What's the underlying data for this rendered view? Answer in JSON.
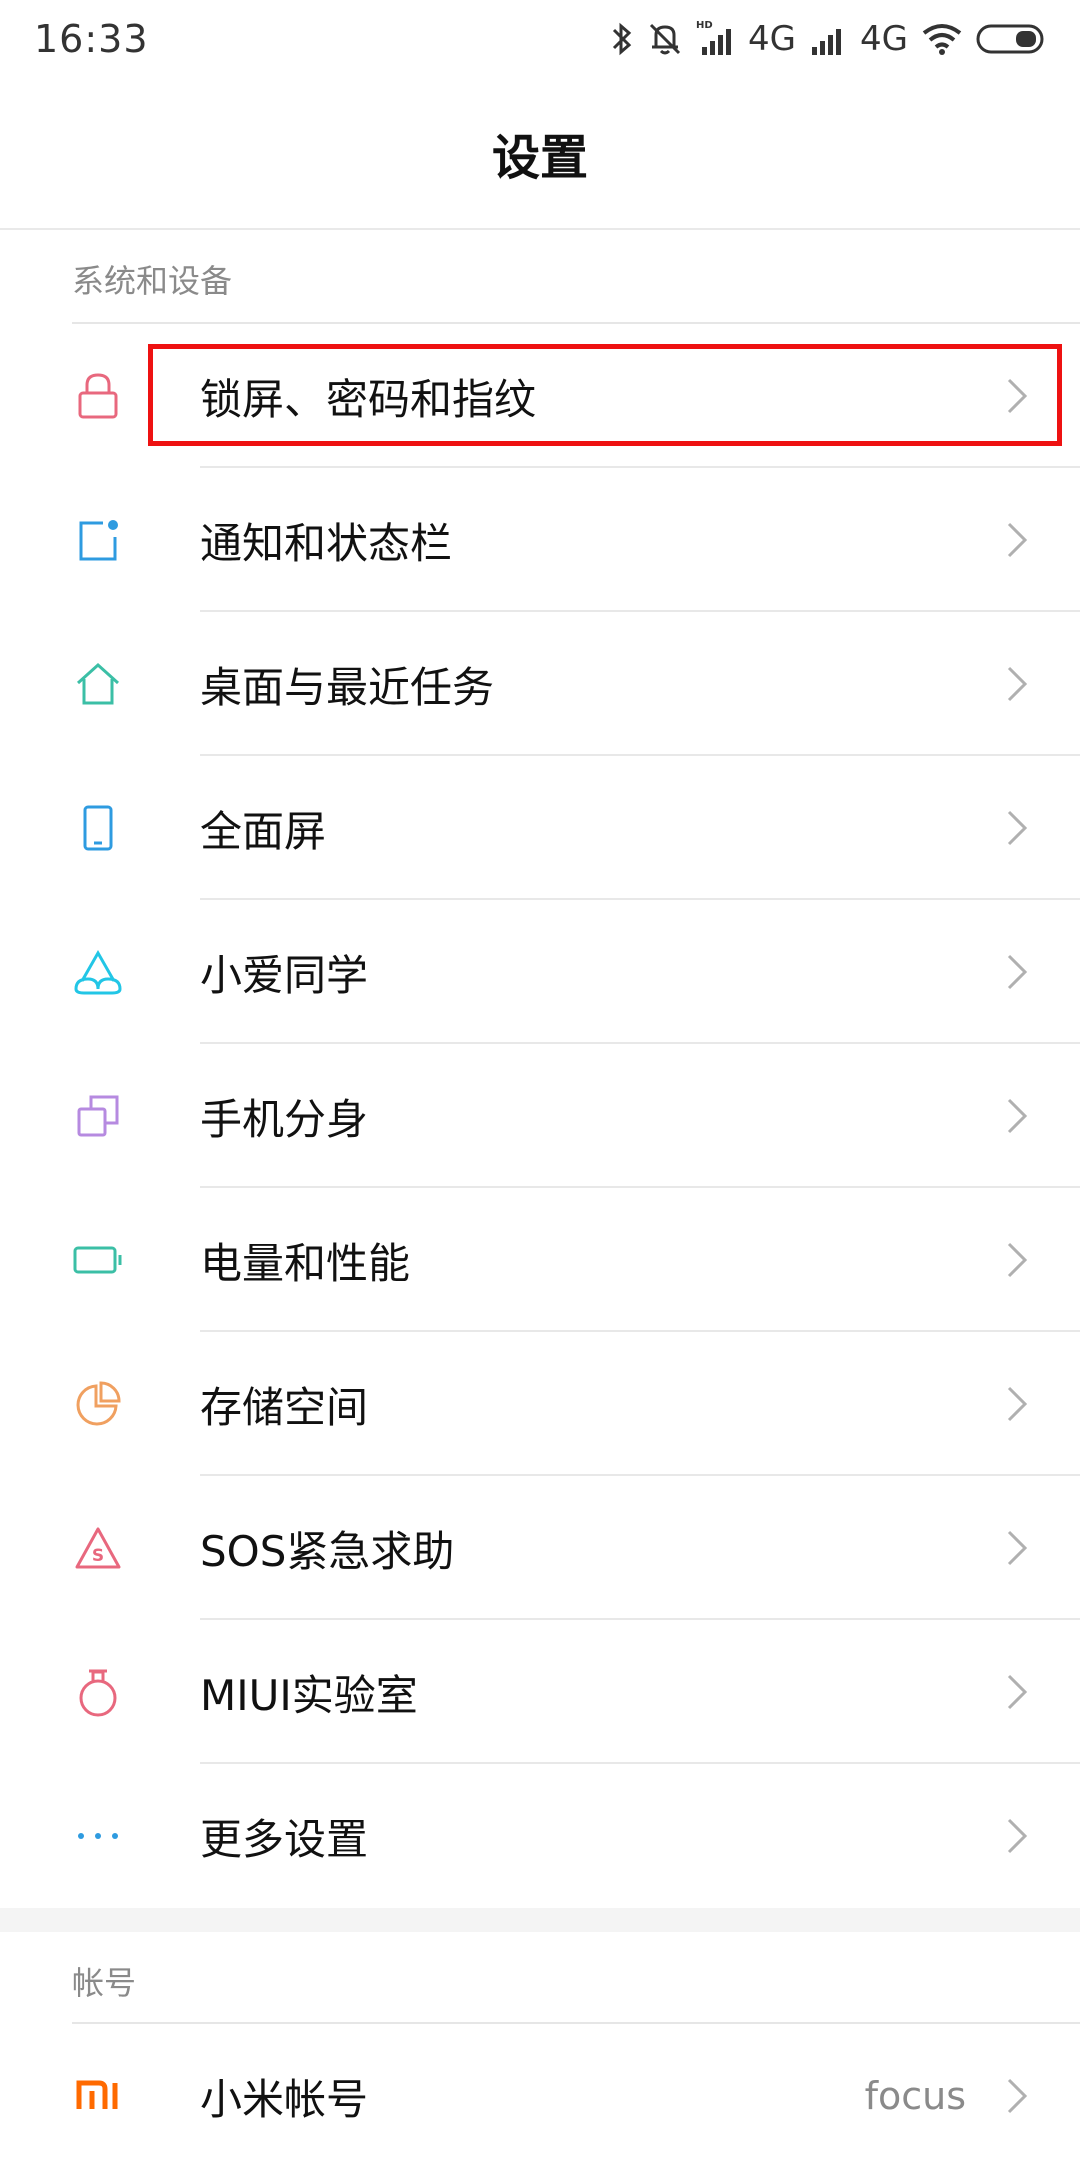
{
  "status_bar": {
    "time": "16:33",
    "network_1": "4G",
    "network_2": "4G",
    "hd_label": "HD",
    "icons": [
      "bluetooth-icon",
      "vibrate-off-icon",
      "signal-icon",
      "signal-icon",
      "wifi-icon",
      "battery-icon"
    ]
  },
  "header": {
    "title": "设置"
  },
  "sections": [
    {
      "label": "系统和设备",
      "items": [
        {
          "label": "锁屏、密码和指纹",
          "icon": "lock-icon",
          "color": "#e8687e"
        },
        {
          "label": "通知和状态栏",
          "icon": "notification-icon",
          "color": "#2e9be0"
        },
        {
          "label": "桌面与最近任务",
          "icon": "home-icon",
          "color": "#3bbfa6"
        },
        {
          "label": "全面屏",
          "icon": "phone-screen-icon",
          "color": "#2e9be0"
        },
        {
          "label": "小爱同学",
          "icon": "xiaoai-icon",
          "color": "#22c6e6"
        },
        {
          "label": "手机分身",
          "icon": "second-space-icon",
          "color": "#b68ae0"
        },
        {
          "label": "电量和性能",
          "icon": "battery-icon",
          "color": "#3bbfa6"
        },
        {
          "label": "存储空间",
          "icon": "storage-pie-icon",
          "color": "#f0a060"
        },
        {
          "label": "SOS紧急求助",
          "icon": "sos-icon",
          "color": "#e8687e"
        },
        {
          "label": "MIUI实验室",
          "icon": "flask-icon",
          "color": "#e8687e"
        },
        {
          "label": "更多设置",
          "icon": "more-dots-icon",
          "color": "#2e9be0"
        }
      ]
    },
    {
      "label": "帐号",
      "items": [
        {
          "label": "小米帐号",
          "value": "focus",
          "icon": "mi-logo-icon",
          "color": "#ff6a00"
        }
      ]
    }
  ],
  "highlight_color": "#ee1111"
}
